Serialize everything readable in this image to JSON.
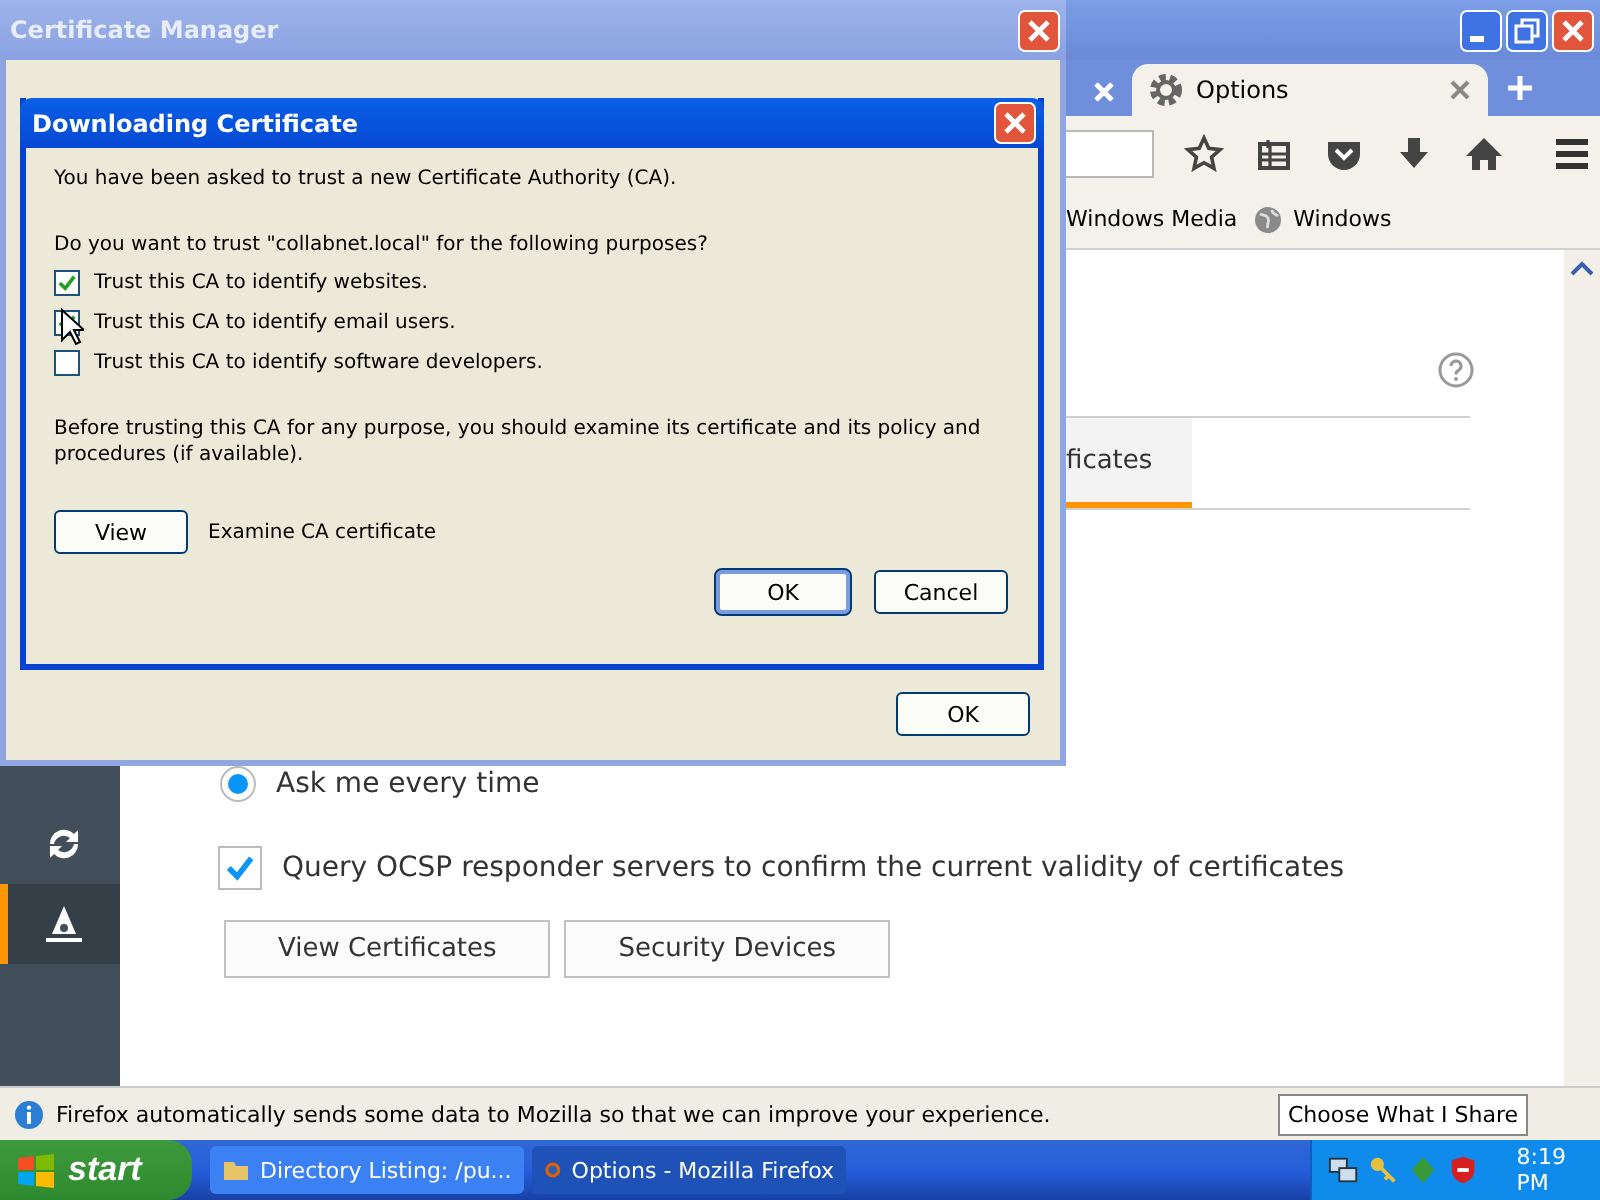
{
  "browser": {
    "tabs": [
      {
        "selected": false
      },
      {
        "label": "Options",
        "selected": true
      }
    ],
    "bookmarks": [
      "Windows Media",
      "Windows"
    ],
    "sidebar": {
      "items": [
        {
          "kind": "sync",
          "selected": false
        },
        {
          "kind": "advanced",
          "selected": true
        }
      ]
    },
    "content": {
      "section_tab": {
        "label": "ficates",
        "selected": true
      },
      "radio": {
        "label": "Ask me every time",
        "selected": true
      },
      "ocsp": {
        "label": "Query OCSP responder servers to confirm the current validity of certificates",
        "checked": true
      },
      "buttons": [
        "View Certificates",
        "Security Devices"
      ]
    },
    "notification": {
      "text": "Firefox automatically sends some data to Mozilla so that we can improve your experience.",
      "button": "Choose What I Share"
    }
  },
  "certificate_manager": {
    "title": "Certificate Manager",
    "button": "OK"
  },
  "dialog": {
    "title": "Downloading Certificate",
    "intro": "You have been asked to trust a new Certificate Authority (CA).",
    "question": "Do you want to trust \"collabnet.local\" for the following purposes?",
    "purposes": [
      {
        "label": "Trust this CA to identify websites.",
        "checked": true
      },
      {
        "label": "Trust this CA to identify email users.",
        "checked": true
      },
      {
        "label": "Trust this CA to identify software developers.",
        "checked": false
      }
    ],
    "warning": "Before trusting this CA for any purpose, you should examine its certificate and its policy and procedures (if available).",
    "view_button": "View",
    "view_label": "Examine CA certificate",
    "buttons": [
      "OK",
      "Cancel"
    ]
  },
  "taskbar": {
    "start": "start",
    "tasks": [
      {
        "label": "Directory Listing: /pu...",
        "selected": false
      },
      {
        "label": "Options - Mozilla Firefox",
        "selected": true
      }
    ],
    "clock": "8:19 PM"
  }
}
